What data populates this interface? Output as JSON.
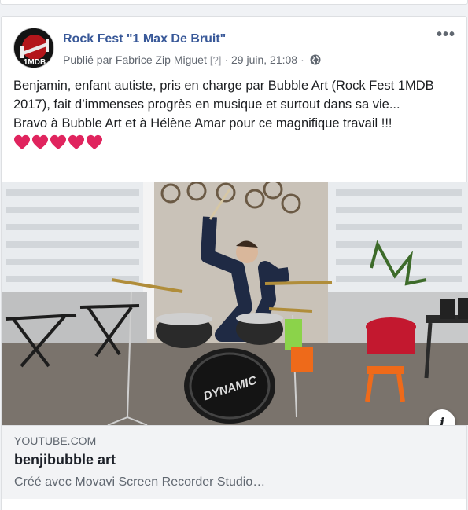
{
  "post": {
    "page_name": "Rock Fest \"1 Max De Bruit\"",
    "avatar_logo_text": "1MDB",
    "published_by": "Publié par Fabrice Zip Miguet",
    "author_marker": "[?]",
    "separator": "·",
    "timestamp": "29 juin, 21:08",
    "separator2": "·",
    "more_label": "•••",
    "text_lines": [
      "Benjamin, enfant autiste, pris en charge par Bubble Art (Rock Fest 1MDB 2017), fait d’immenses progrès en musique et surtout dans sa vie...",
      "Bravo à Bubble Art et à Hélène Amar pour ce magnifique travail !!!"
    ],
    "hearts_count": 5,
    "heart_color": "#e0245e"
  },
  "video": {
    "drum_brand": "DYNAMIC",
    "info_label": "i"
  },
  "link": {
    "domain": "YOUTUBE.COM",
    "title": "benjibubble art",
    "description": "Créé avec Movavi Screen Recorder Studio…"
  },
  "colors": {
    "link_blue": "#385898",
    "meta_gray": "#616770"
  }
}
